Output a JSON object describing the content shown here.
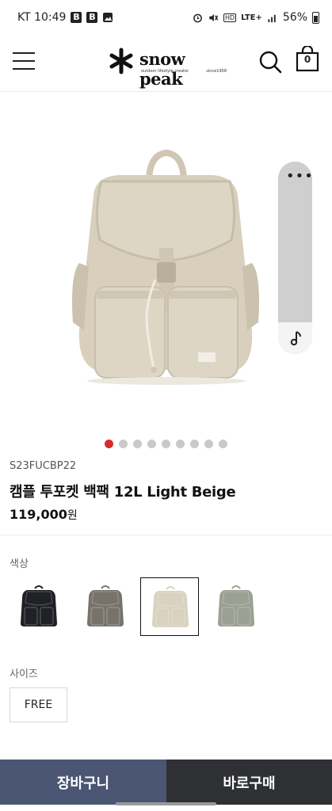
{
  "status_bar": {
    "carrier_time": "KT 10:49",
    "notif_icons": [
      "B",
      "B"
    ],
    "network": "LTE+",
    "battery": "56%"
  },
  "header": {
    "brand": "snow peak",
    "brand_sub_left": "outdoor lifestyle creator",
    "brand_sub_right": "since1958",
    "cart_count": "0"
  },
  "product": {
    "code": "S23FUCBP22",
    "name": "캠플 투포켓 백팩 12L Light Beige",
    "price": "119,000",
    "currency": "원",
    "image_count": 9,
    "active_image": 0
  },
  "options": {
    "color_label": "색상",
    "colors": [
      {
        "name": "Black",
        "hex": "#1f2124"
      },
      {
        "name": "Gray",
        "hex": "#77736b"
      },
      {
        "name": "Light Beige",
        "hex": "#d9d2c1",
        "selected": true
      },
      {
        "name": "Khaki",
        "hex": "#9aa093"
      }
    ],
    "size_label": "사이즈",
    "size_value": "FREE"
  },
  "actions": {
    "cart_label": "장바구니",
    "buy_label": "바로구매"
  },
  "colors": {
    "accent_dot": "#d92b2b",
    "cart_button": "#4a5673",
    "buy_button": "#2f3033"
  }
}
